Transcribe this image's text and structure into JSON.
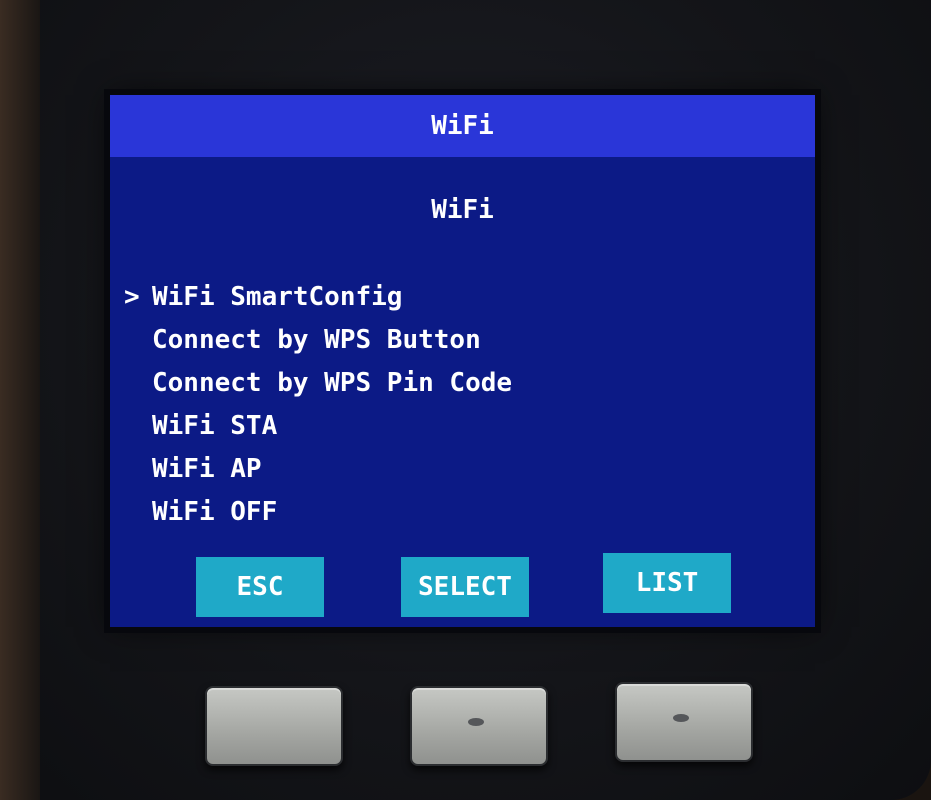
{
  "screen": {
    "title": "WiFi",
    "heading": "WiFi",
    "cursor": ">",
    "menu_items": [
      {
        "label": "WiFi SmartConfig"
      },
      {
        "label": "Connect by WPS Button"
      },
      {
        "label": "Connect by WPS Pin Code"
      },
      {
        "label": "WiFi STA"
      },
      {
        "label": "WiFi AP"
      },
      {
        "label": "WiFi OFF"
      }
    ],
    "softkeys": {
      "esc": "ESC",
      "select": "SELECT",
      "list": "LIST"
    }
  },
  "colors": {
    "screen_background": "#0c1a86",
    "title_bar": "#2a36d8",
    "softkey": "#1fa9c8",
    "text": "#ffffff"
  }
}
